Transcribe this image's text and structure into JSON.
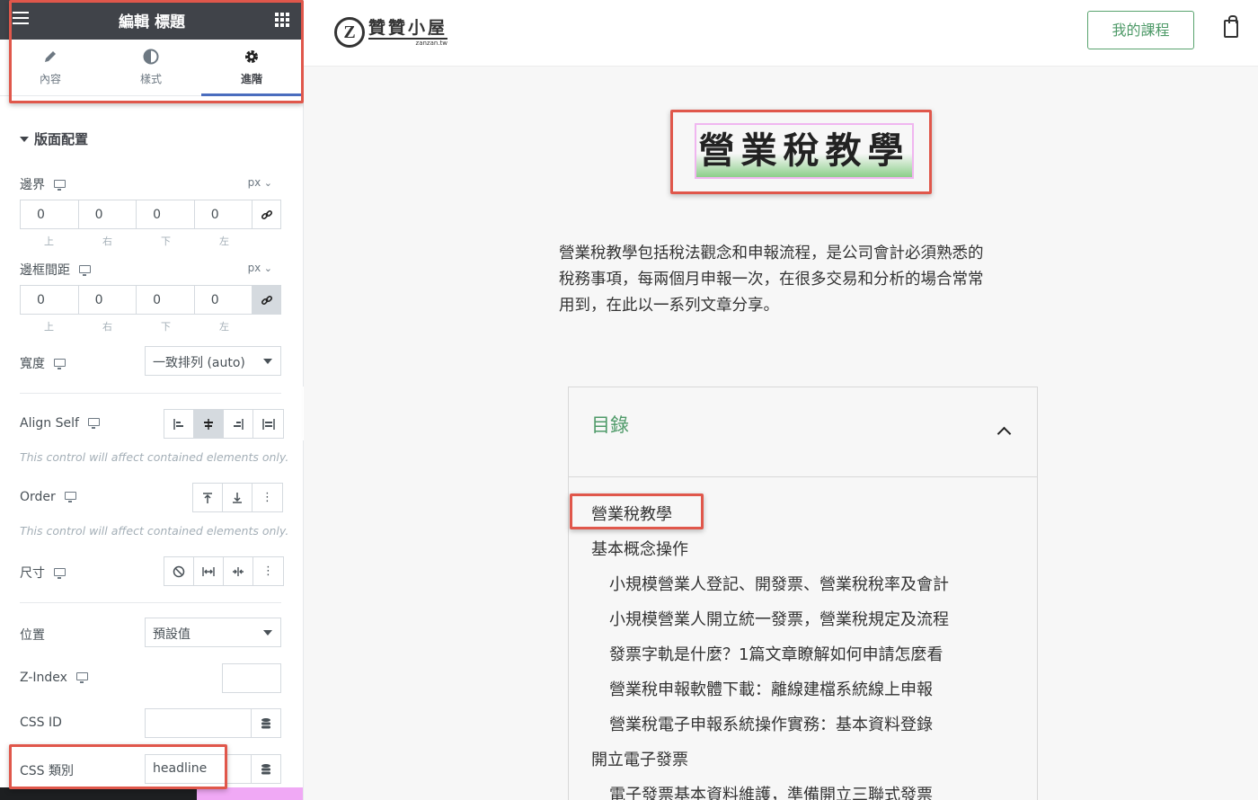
{
  "panel": {
    "header_title": "編輯 標題",
    "tabs": [
      {
        "label": "內容",
        "icon": "pencil-icon"
      },
      {
        "label": "樣式",
        "icon": "half-circle-icon"
      },
      {
        "label": "進階",
        "icon": "gear-icon",
        "active": true
      }
    ],
    "section_title": "版面配置",
    "margin": {
      "label": "邊界",
      "unit": "px",
      "values": [
        "0",
        "0",
        "0",
        "0"
      ],
      "sublabels": [
        "上",
        "右",
        "下",
        "左"
      ],
      "linked": false
    },
    "padding": {
      "label": "邊框間距",
      "unit": "px",
      "values": [
        "0",
        "0",
        "0",
        "0"
      ],
      "sublabels": [
        "上",
        "右",
        "下",
        "左"
      ],
      "linked": true
    },
    "width": {
      "label": "寬度",
      "value": "一致排列 (auto)"
    },
    "align_self": {
      "label": "Align Self",
      "note": "This control will affect contained elements only.",
      "selected_index": 1
    },
    "order": {
      "label": "Order",
      "note": "This control will affect contained elements only."
    },
    "size": {
      "label": "尺寸"
    },
    "position": {
      "label": "位置",
      "value": "預設值"
    },
    "z_index": {
      "label": "Z-Index",
      "value": ""
    },
    "css_id": {
      "label": "CSS ID",
      "value": ""
    },
    "css_classes": {
      "label": "CSS 類別",
      "value": "headline"
    }
  },
  "site": {
    "logo_name": "贊贊小屋",
    "logo_mark": "Z",
    "logo_url": "zanzan.tw",
    "my_courses_label": "我的課程",
    "hero_title": "營業稅教學",
    "intro_lines": [
      "營業稅教學包括稅法觀念和申報流程，是公司會計必須熟悉的",
      "稅務事項，每兩個月申報一次，在很多交易和分析的場合常常",
      "用到，在此以一系列文章分享。"
    ],
    "toc": {
      "title": "目錄",
      "items": [
        {
          "level": 1,
          "text": "營業稅教學"
        },
        {
          "level": 1,
          "text": "基本概念操作"
        },
        {
          "level": 2,
          "text": "小規模營業人登記、開發票、營業稅稅率及會計"
        },
        {
          "level": 2,
          "text": "小規模營業人開立統一發票，營業稅規定及流程"
        },
        {
          "level": 2,
          "text": "發票字軌是什麼？1篇文章瞭解如何申請怎麼看"
        },
        {
          "level": 2,
          "text": "營業稅申報軟體下載：離線建檔系統線上申報"
        },
        {
          "level": 2,
          "text": "營業稅電子申報系統操作實務：基本資料登錄"
        },
        {
          "level": 1,
          "text": "開立電子發票"
        },
        {
          "level": 2,
          "text": "電子發票基本資料維護，準備開立三聯式發票"
        }
      ]
    }
  },
  "colors": {
    "panel_header": "#404349",
    "active_tab_underline": "#4a6dbe",
    "highlight_box": "#e0574b",
    "accent_green": "#4e9a68",
    "hero_underline": "#8ccf8a"
  }
}
